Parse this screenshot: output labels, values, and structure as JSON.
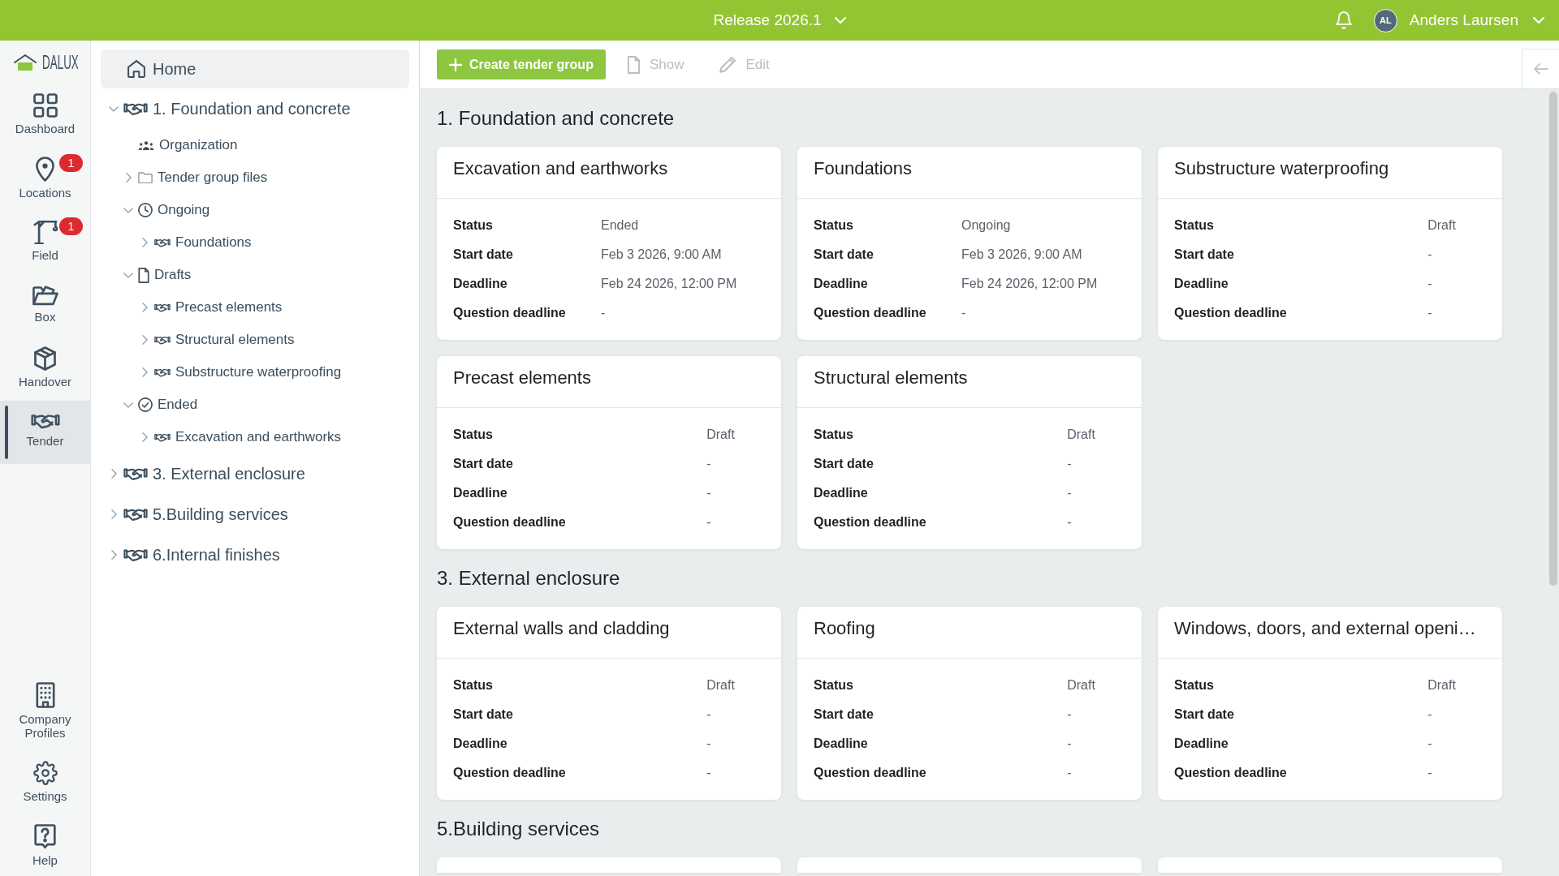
{
  "top_bar": {
    "release": "Release 2026.1",
    "user": {
      "initials": "AL",
      "name": "Anders Laursen"
    }
  },
  "nav_rail": {
    "logo": "DALUX",
    "items": [
      {
        "label": "Dashboard",
        "selected": false
      },
      {
        "label": "Locations",
        "badge": "1",
        "selected": false
      },
      {
        "label": "Field",
        "badge": "1",
        "selected": false
      },
      {
        "label": "Box",
        "selected": false
      },
      {
        "label": "Handover",
        "selected": false
      },
      {
        "label": "Tender",
        "selected": true
      }
    ],
    "bottom_items": [
      {
        "label": "Company Profiles",
        "selected": false
      },
      {
        "label": "Settings",
        "selected": false
      },
      {
        "label": "Help",
        "selected": false
      }
    ]
  },
  "sidebar": {
    "home": {
      "label": "Home",
      "selected": true
    },
    "tree": [
      {
        "label": "1. Foundation and concrete",
        "kind": "tender",
        "expanded": true,
        "selected": false,
        "children": [
          {
            "label": "Organization",
            "kind": "organization",
            "selected": false
          },
          {
            "label": "Tender group files",
            "kind": "files",
            "expanded": false,
            "selected": false
          },
          {
            "label": "Ongoing",
            "kind": "ongoing",
            "expanded": true,
            "selected": false,
            "children": [
              {
                "label": "Foundations",
                "kind": "tender",
                "expanded": false,
                "selected": false
              }
            ]
          },
          {
            "label": "Drafts",
            "kind": "drafts",
            "expanded": true,
            "selected": false,
            "children": [
              {
                "label": "Precast elements",
                "kind": "tender",
                "expanded": false,
                "selected": false
              },
              {
                "label": "Structural elements",
                "kind": "tender",
                "expanded": false,
                "selected": false
              },
              {
                "label": "Substructure waterproofing",
                "kind": "tender",
                "expanded": false,
                "selected": false
              }
            ]
          },
          {
            "label": "Ended",
            "kind": "ended",
            "expanded": true,
            "selected": false,
            "children": [
              {
                "label": "Excavation and earthworks",
                "kind": "tender",
                "expanded": false,
                "selected": false
              }
            ]
          }
        ]
      },
      {
        "label": "3. External enclosure",
        "kind": "tender",
        "expanded": false,
        "selected": false
      },
      {
        "label": "5.Building services",
        "kind": "tender",
        "expanded": false,
        "selected": false
      },
      {
        "label": "6.Internal finishes",
        "kind": "tender",
        "expanded": false,
        "selected": false
      }
    ]
  },
  "toolbar": {
    "buttons": [
      {
        "label": "Create tender group",
        "kind": "primary",
        "disabled": false
      },
      {
        "label": "Show",
        "kind": "plain",
        "disabled": true
      },
      {
        "label": "Edit",
        "kind": "plain",
        "disabled": true
      }
    ]
  },
  "content": {
    "sections": [
      {
        "title": "1. Foundation and concrete",
        "cards": [
          {
            "kind": "full",
            "title": "Excavation and earthworks",
            "fields": [
              {
                "label": "Status",
                "value": "Ended"
              },
              {
                "label": "Start date",
                "value": "Feb 3 2026, 9:00 AM"
              },
              {
                "label": "Deadline",
                "value": "Feb 24 2026, 12:00 PM"
              },
              {
                "label": "Question deadline",
                "value": "-"
              }
            ]
          },
          {
            "kind": "full",
            "title": "Foundations",
            "fields": [
              {
                "label": "Status",
                "value": "Ongoing"
              },
              {
                "label": "Start date",
                "value": "Feb 3 2026, 9:00 AM"
              },
              {
                "label": "Deadline",
                "value": "Feb 24 2026, 12:00 PM"
              },
              {
                "label": "Question deadline",
                "value": "-"
              }
            ]
          },
          {
            "kind": "full",
            "title": "Substructure waterproofing",
            "fields": [
              {
                "label": "Status",
                "value": "Draft"
              },
              {
                "label": "Start date",
                "value": "-"
              },
              {
                "label": "Deadline",
                "value": "-"
              },
              {
                "label": "Question deadline",
                "value": "-"
              }
            ]
          },
          {
            "kind": "full",
            "title": "Precast elements",
            "fields": [
              {
                "label": "Status",
                "value": "Draft"
              },
              {
                "label": "Start date",
                "value": "-"
              },
              {
                "label": "Deadline",
                "value": "-"
              },
              {
                "label": "Question deadline",
                "value": "-"
              }
            ]
          },
          {
            "kind": "full",
            "title": "Structural elements",
            "fields": [
              {
                "label": "Status",
                "value": "Draft"
              },
              {
                "label": "Start date",
                "value": "-"
              },
              {
                "label": "Deadline",
                "value": "-"
              },
              {
                "label": "Question deadline",
                "value": "-"
              }
            ]
          }
        ]
      },
      {
        "title": "3. External enclosure",
        "cards": [
          {
            "kind": "full",
            "title": "External walls and cladding",
            "fields": [
              {
                "label": "Status",
                "value": "Draft"
              },
              {
                "label": "Start date",
                "value": "-"
              },
              {
                "label": "Deadline",
                "value": "-"
              },
              {
                "label": "Question deadline",
                "value": "-"
              }
            ]
          },
          {
            "kind": "full",
            "title": "Roofing",
            "fields": [
              {
                "label": "Status",
                "value": "Draft"
              },
              {
                "label": "Start date",
                "value": "-"
              },
              {
                "label": "Deadline",
                "value": "-"
              },
              {
                "label": "Question deadline",
                "value": "-"
              }
            ]
          },
          {
            "kind": "full",
            "title": "Windows, doors, and external openi…",
            "fields": [
              {
                "label": "Status",
                "value": "Draft"
              },
              {
                "label": "Start date",
                "value": "-"
              },
              {
                "label": "Deadline",
                "value": "-"
              },
              {
                "label": "Question deadline",
                "value": "-"
              }
            ]
          }
        ]
      },
      {
        "title": "5.Building services",
        "cards": [
          {
            "kind": "clipped"
          },
          {
            "kind": "clipped"
          },
          {
            "kind": "clipped"
          }
        ]
      }
    ]
  }
}
